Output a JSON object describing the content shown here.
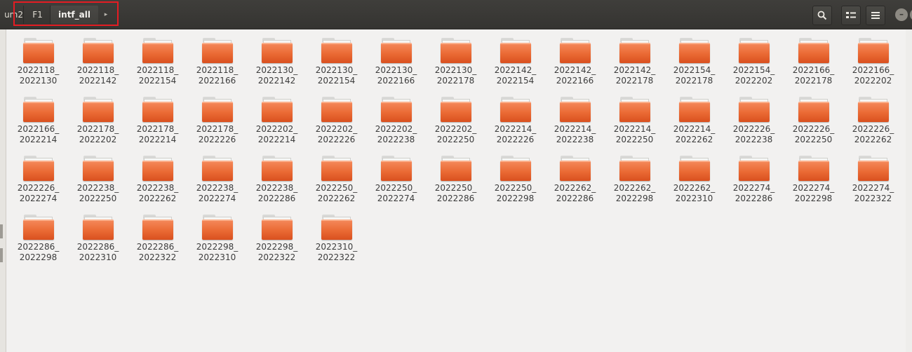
{
  "breadcrumb": {
    "partial_label": "um2",
    "items": [
      "F1",
      "intf_all"
    ],
    "next_arrow": "▸"
  },
  "toolbar": {
    "search_icon": "search-icon",
    "view_icon": "list-view-icon",
    "menu_icon": "hamburger-menu-icon",
    "minimize_label": "–"
  },
  "colors": {
    "accent_highlight": "#e51c23",
    "folder_orange": "#ea6a34",
    "header_bg": "#3c3b37"
  },
  "folders": [
    [
      "2022118_",
      "2022130"
    ],
    [
      "2022118_",
      "2022142"
    ],
    [
      "2022118_",
      "2022154"
    ],
    [
      "2022118_",
      "2022166"
    ],
    [
      "2022130_",
      "2022142"
    ],
    [
      "2022130_",
      "2022154"
    ],
    [
      "2022130_",
      "2022166"
    ],
    [
      "2022130_",
      "2022178"
    ],
    [
      "2022142_",
      "2022154"
    ],
    [
      "2022142_",
      "2022166"
    ],
    [
      "2022142_",
      "2022178"
    ],
    [
      "2022154_",
      "2022178"
    ],
    [
      "2022154_",
      "2022202"
    ],
    [
      "2022166_",
      "2022178"
    ],
    [
      "2022166_",
      "2022202"
    ],
    [
      "2022166_",
      "2022214"
    ],
    [
      "2022178_",
      "2022202"
    ],
    [
      "2022178_",
      "2022214"
    ],
    [
      "2022178_",
      "2022226"
    ],
    [
      "2022202_",
      "2022214"
    ],
    [
      "2022202_",
      "2022226"
    ],
    [
      "2022202_",
      "2022238"
    ],
    [
      "2022202_",
      "2022250"
    ],
    [
      "2022214_",
      "2022226"
    ],
    [
      "2022214_",
      "2022238"
    ],
    [
      "2022214_",
      "2022250"
    ],
    [
      "2022214_",
      "2022262"
    ],
    [
      "2022226_",
      "2022238"
    ],
    [
      "2022226_",
      "2022250"
    ],
    [
      "2022226_",
      "2022262"
    ],
    [
      "2022226_",
      "2022274"
    ],
    [
      "2022238_",
      "2022250"
    ],
    [
      "2022238_",
      "2022262"
    ],
    [
      "2022238_",
      "2022274"
    ],
    [
      "2022238_",
      "2022286"
    ],
    [
      "2022250_",
      "2022262"
    ],
    [
      "2022250_",
      "2022274"
    ],
    [
      "2022250_",
      "2022286"
    ],
    [
      "2022250_",
      "2022298"
    ],
    [
      "2022262_",
      "2022286"
    ],
    [
      "2022262_",
      "2022298"
    ],
    [
      "2022262_",
      "2022310"
    ],
    [
      "2022274_",
      "2022286"
    ],
    [
      "2022274_",
      "2022298"
    ],
    [
      "2022274_",
      "2022322"
    ],
    [
      "2022286_",
      "2022298"
    ],
    [
      "2022286_",
      "2022310"
    ],
    [
      "2022286_",
      "2022322"
    ],
    [
      "2022298_",
      "2022310"
    ],
    [
      "2022298_",
      "2022322"
    ],
    [
      "2022310_",
      "2022322"
    ]
  ]
}
